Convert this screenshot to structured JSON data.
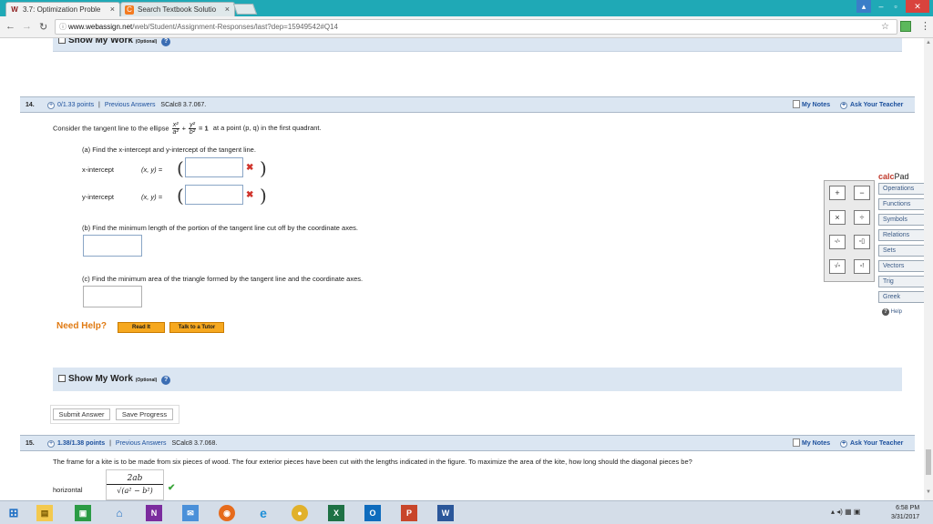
{
  "browser": {
    "tabs": [
      {
        "label": "3.7: Optimization Proble",
        "active": true,
        "favicon": "webassign-icon"
      },
      {
        "label": "Search Textbook Solutio",
        "active": false,
        "favicon": "chegg-icon"
      }
    ],
    "url_host": "www.webassign.net",
    "url_path": "/web/Student/Assignment-Responses/last?dep=15949542#Q14",
    "window_buttons": [
      "minimize-icon",
      "maximize-icon",
      "close-icon"
    ]
  },
  "q13": {
    "show_work_label": "Show My Work",
    "show_work_optional": "(Optional)"
  },
  "q14": {
    "number": "14.",
    "points": "0/1.33 points",
    "separator": "|",
    "previous_answers": "Previous Answers",
    "source": "SCalc8 3.7.067.",
    "my_notes": "My Notes",
    "ask_teacher": "Ask Your Teacher",
    "prompt_before": "Consider the tangent line to the ellipse",
    "eq_frac1_top": "x²",
    "eq_frac1_bot": "a²",
    "eq_plus": "+",
    "eq_frac2_top": "y²",
    "eq_frac2_bot": "b²",
    "eq_rhs": "= 1",
    "prompt_after": "at a point (p, q) in the first quadrant.",
    "part_a": "(a) Find the x-intercept and y-intercept of the tangent line.",
    "x_intercept_label": "x-intercept",
    "y_intercept_label": "y-intercept",
    "xy_label": "(x, y) =",
    "x_intercept_value": "",
    "y_intercept_value": "",
    "part_b": "(b) Find the minimum length of the portion of the tangent line cut off by the coordinate axes.",
    "part_b_value": "",
    "part_c": "(c) Find the minimum area of the triangle formed by the tangent line and the coordinate axes.",
    "part_c_value": "",
    "need_help": "Need Help?",
    "read_it": "Read It",
    "talk_tutor": "Talk to a Tutor",
    "show_work_label": "Show My Work",
    "show_work_optional": "(Optional)",
    "submit": "Submit Answer",
    "save": "Save Progress"
  },
  "calcpad": {
    "title_a": "calc",
    "title_b": "Pad",
    "keys": [
      "+",
      "−",
      "×",
      "÷",
      "▫/▫",
      "▫▯",
      "√▫",
      "▫!"
    ],
    "menus": [
      "Operations",
      "Functions",
      "Symbols",
      "Relations",
      "Sets",
      "Vectors",
      "Trig",
      "Greek"
    ],
    "help": "Help"
  },
  "q15": {
    "number": "15.",
    "points": "1.38/1.38 points",
    "separator": "|",
    "previous_answers": "Previous Answers",
    "source": "SCalc8 3.7.068.",
    "my_notes": "My Notes",
    "ask_teacher": "Ask Your Teacher",
    "prompt": "The frame for a kite is to be made from six pieces of wood. The four exterior pieces have been cut with the lengths indicated in the figure. To maximize the area of the kite, how long should the diagonal pieces be?",
    "horizontal_label": "horizontal",
    "answer_top": "2ab",
    "answer_bottom": "√(a² − b²)"
  },
  "taskbar": {
    "icons": [
      "start-icon",
      "file-explorer-icon",
      "store-icon",
      "home-icon",
      "onenote-icon",
      "mail-icon",
      "firefox-icon",
      "ie-icon",
      "chrome-icon",
      "excel-icon",
      "outlook-icon",
      "powerpoint-icon",
      "word-icon"
    ],
    "time": "6:58 PM",
    "date": "3/31/2017"
  }
}
